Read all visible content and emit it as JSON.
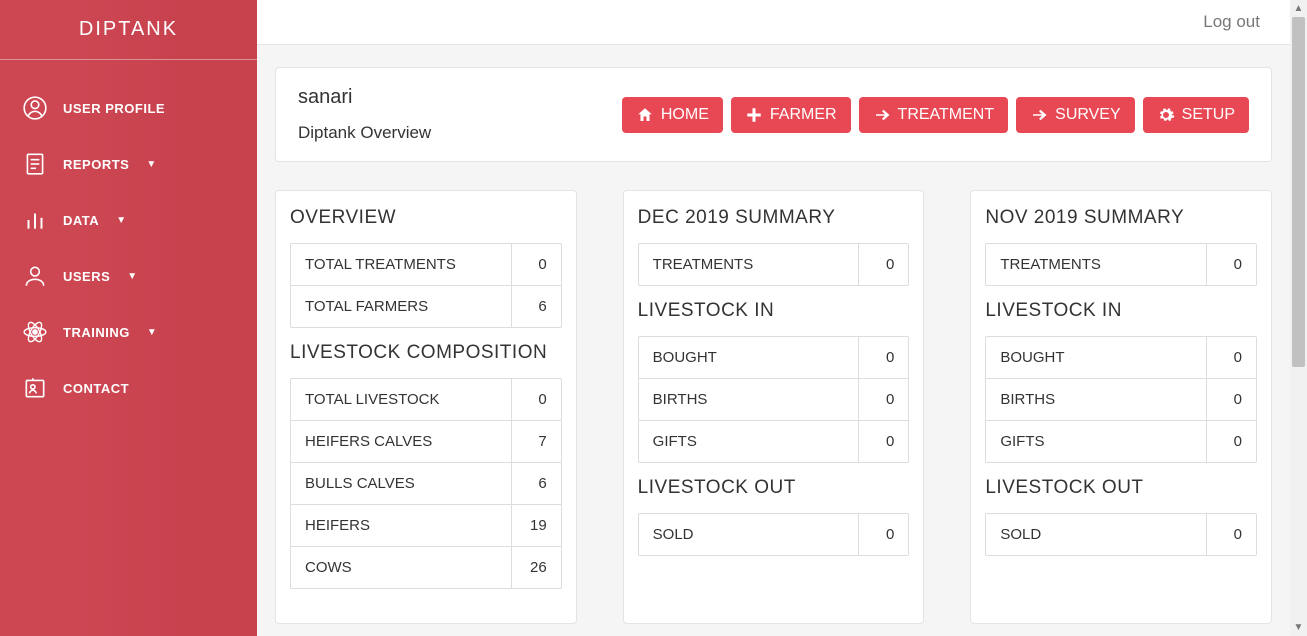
{
  "brand": "DIPTANK",
  "topbar": {
    "logout": "Log out"
  },
  "sidebar": {
    "items": [
      {
        "label": "USER PROFILE",
        "has_caret": false
      },
      {
        "label": "REPORTS",
        "has_caret": true
      },
      {
        "label": "DATA",
        "has_caret": true
      },
      {
        "label": "USERS",
        "has_caret": true
      },
      {
        "label": "TRAINING",
        "has_caret": true
      },
      {
        "label": "CONTACT",
        "has_caret": false
      }
    ]
  },
  "header": {
    "title": "sanari",
    "subtitle": "Diptank Overview",
    "actions": {
      "home": "HOME",
      "farmer": "FARMER",
      "treatment": "TREATMENT",
      "survey": "SURVEY",
      "setup": "SETUP"
    }
  },
  "overview": {
    "heading": "OVERVIEW",
    "totals": [
      {
        "label": "TOTAL TREATMENTS",
        "value": "0"
      },
      {
        "label": "TOTAL FARMERS",
        "value": "6"
      }
    ],
    "composition_heading": "LIVESTOCK COMPOSITION",
    "composition": [
      {
        "label": "TOTAL LIVESTOCK",
        "value": "0"
      },
      {
        "label": "HEIFERS CALVES",
        "value": "7"
      },
      {
        "label": "BULLS CALVES",
        "value": "6"
      },
      {
        "label": "HEIFERS",
        "value": "19"
      },
      {
        "label": "COWS",
        "value": "26"
      }
    ]
  },
  "month_a": {
    "heading": "DEC 2019 SUMMARY",
    "treatments": [
      {
        "label": "TREATMENTS",
        "value": "0"
      }
    ],
    "in_heading": "LIVESTOCK IN",
    "in": [
      {
        "label": "BOUGHT",
        "value": "0"
      },
      {
        "label": "BIRTHS",
        "value": "0"
      },
      {
        "label": "GIFTS",
        "value": "0"
      }
    ],
    "out_heading": "LIVESTOCK OUT",
    "out": [
      {
        "label": "SOLD",
        "value": "0"
      }
    ]
  },
  "month_b": {
    "heading": "NOV 2019 SUMMARY",
    "treatments": [
      {
        "label": "TREATMENTS",
        "value": "0"
      }
    ],
    "in_heading": "LIVESTOCK IN",
    "in": [
      {
        "label": "BOUGHT",
        "value": "0"
      },
      {
        "label": "BIRTHS",
        "value": "0"
      },
      {
        "label": "GIFTS",
        "value": "0"
      }
    ],
    "out_heading": "LIVESTOCK OUT",
    "out": [
      {
        "label": "SOLD",
        "value": "0"
      }
    ]
  }
}
